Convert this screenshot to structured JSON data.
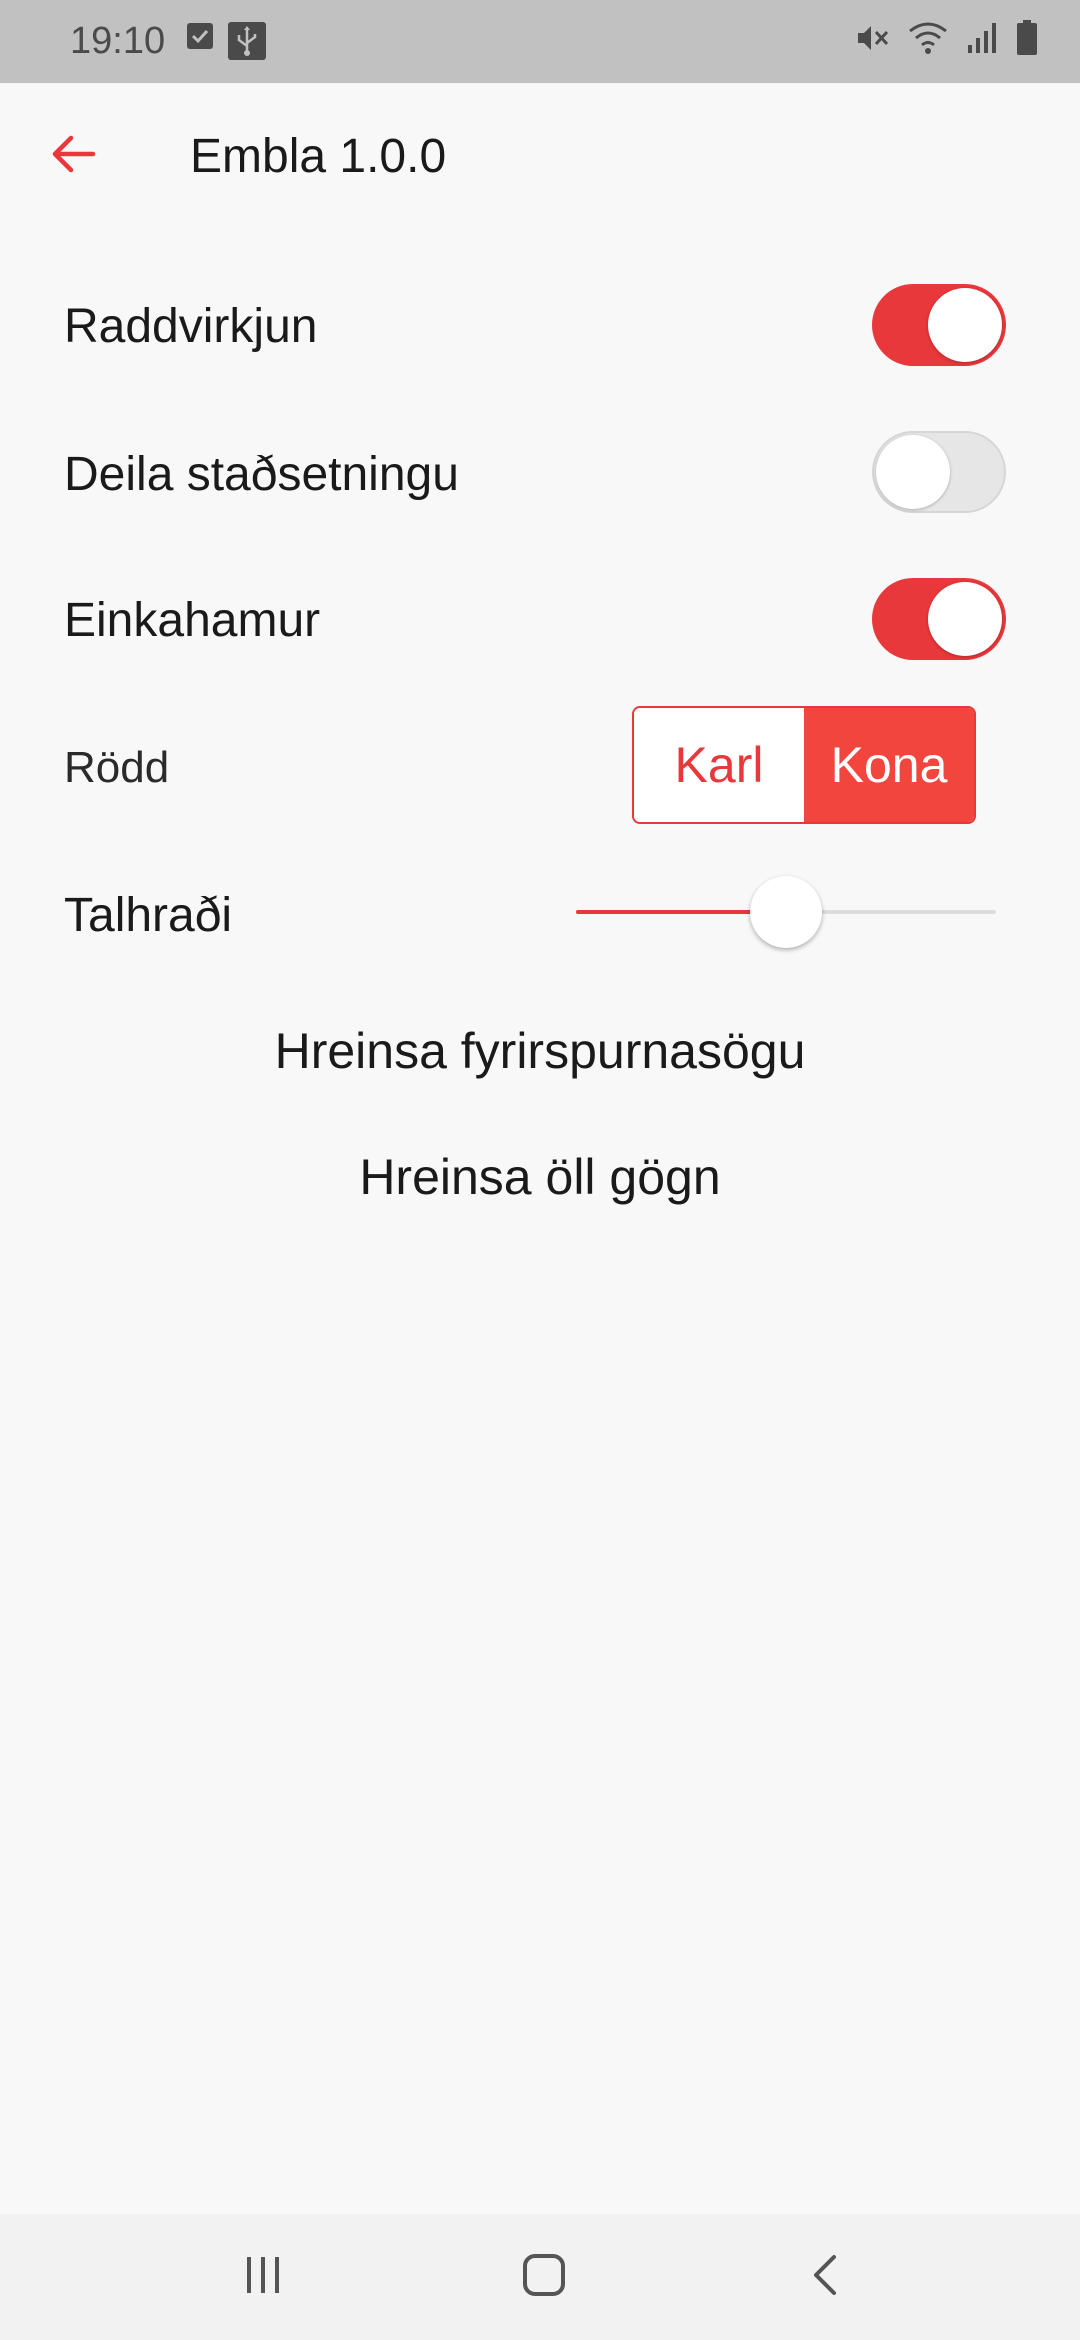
{
  "status_bar": {
    "time": "19:10",
    "left_icons": [
      "checkbox-notification-icon",
      "usb-icon"
    ],
    "right_icons": [
      "mute-icon",
      "wifi-icon",
      "signal-icon",
      "battery-icon"
    ]
  },
  "app_bar": {
    "back_icon": "arrow-left-icon",
    "title": "Embla 1.0.0"
  },
  "settings": {
    "voice_activation": {
      "label": "Raddvirkjun",
      "enabled": true
    },
    "share_location": {
      "label": "Deila staðsetningu",
      "enabled": false
    },
    "privacy_mode": {
      "label": "Einkahamur",
      "enabled": true
    },
    "voice": {
      "label": "Rödd",
      "options": [
        "Karl",
        "Kona"
      ],
      "selected": "Kona"
    },
    "speech_rate": {
      "label": "Talhraði",
      "value_fraction": 0.5
    }
  },
  "actions": {
    "clear_query_history": "Hreinsa fyrirspurnasögu",
    "clear_all_data": "Hreinsa öll gögn"
  },
  "nav_bar": {
    "icons": [
      "recent-apps-icon",
      "home-icon",
      "back-icon"
    ]
  },
  "colors": {
    "accent": "#e8383b",
    "segment_selected": "#f2453d",
    "background": "#f8f8f8",
    "status_bar": "#c1c1c1"
  }
}
